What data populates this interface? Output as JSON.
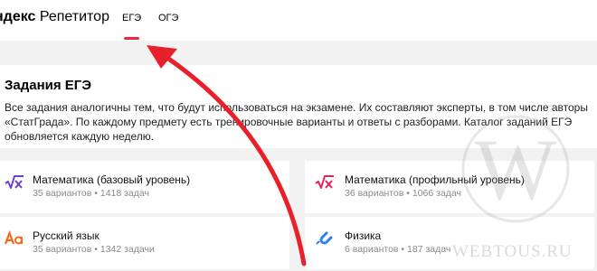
{
  "header": {
    "logo_brand": "ндекс",
    "logo_product": " Репетитор",
    "tabs": [
      {
        "label": "ЕГЭ",
        "active": true
      },
      {
        "label": "ОГЭ",
        "active": false
      }
    ]
  },
  "intro": {
    "title": "Задания ЕГЭ",
    "text": "Все задания аналогичны тем, что будут использоваться на экзамене. Их составляют эксперты, в том числе авторы «СтатГрада». По каждому предмету есть тренировочные варианты и ответы с разборами. Каталог заданий ЕГЭ обновляется каждую неделю."
  },
  "subjects": [
    {
      "icon": "square-root-x-icon",
      "title": "Математика (базовый уровень)",
      "meta": "35 вариантов • 1418 задач",
      "color": "#6c3fd8"
    },
    {
      "icon": "square-root-x-icon",
      "title": "Математика (профильный уровень)",
      "meta": "36 вариантов • 1066 задач",
      "color": "#e0245e"
    },
    {
      "icon": "aa-letters-icon",
      "title": "Русский язык",
      "meta": "35 вариантов • 1342 задачи",
      "color": "#f26a1b"
    },
    {
      "icon": "magnet-icon",
      "title": "Физика",
      "meta": "6 вариантов • 187 задач",
      "color": "#2f80ed"
    }
  ],
  "watermark": {
    "text": "WEBTOUS.RU"
  },
  "colors": {
    "accent": "#e8283c",
    "arrow": "#e8202a",
    "background": "#f2f2f2"
  }
}
